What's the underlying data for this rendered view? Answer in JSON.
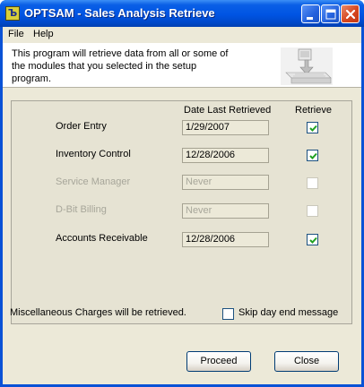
{
  "window": {
    "title": "OPTSAM - Sales Analysis Retrieve",
    "icon_letter": "Ъ"
  },
  "menu": {
    "file": "File",
    "help": "Help"
  },
  "banner": {
    "text": "This program will retrieve data from all or some of the modules that you selected in the setup program."
  },
  "table": {
    "col_date": "Date Last Retrieved",
    "col_retrieve": "Retrieve",
    "rows": [
      {
        "label": "Order Entry",
        "date": "1/29/2007",
        "checked": true,
        "enabled": true
      },
      {
        "label": "Inventory Control",
        "date": "12/28/2006",
        "checked": true,
        "enabled": true
      },
      {
        "label": "Service Manager",
        "date": "Never",
        "checked": false,
        "enabled": false
      },
      {
        "label": "D-Bit Billing",
        "date": "Never",
        "checked": false,
        "enabled": false
      },
      {
        "label": "Accounts Receivable",
        "date": "12/28/2006",
        "checked": true,
        "enabled": true
      }
    ]
  },
  "footer": {
    "misc_text": "Miscellaneous Charges will be retrieved.",
    "skip_label": "Skip day end message",
    "skip_checked": false
  },
  "buttons": {
    "proceed": "Proceed",
    "close": "Close"
  },
  "colors": {
    "title_bar": "#0054e3",
    "face": "#ece9d8",
    "check": "#21a121"
  }
}
